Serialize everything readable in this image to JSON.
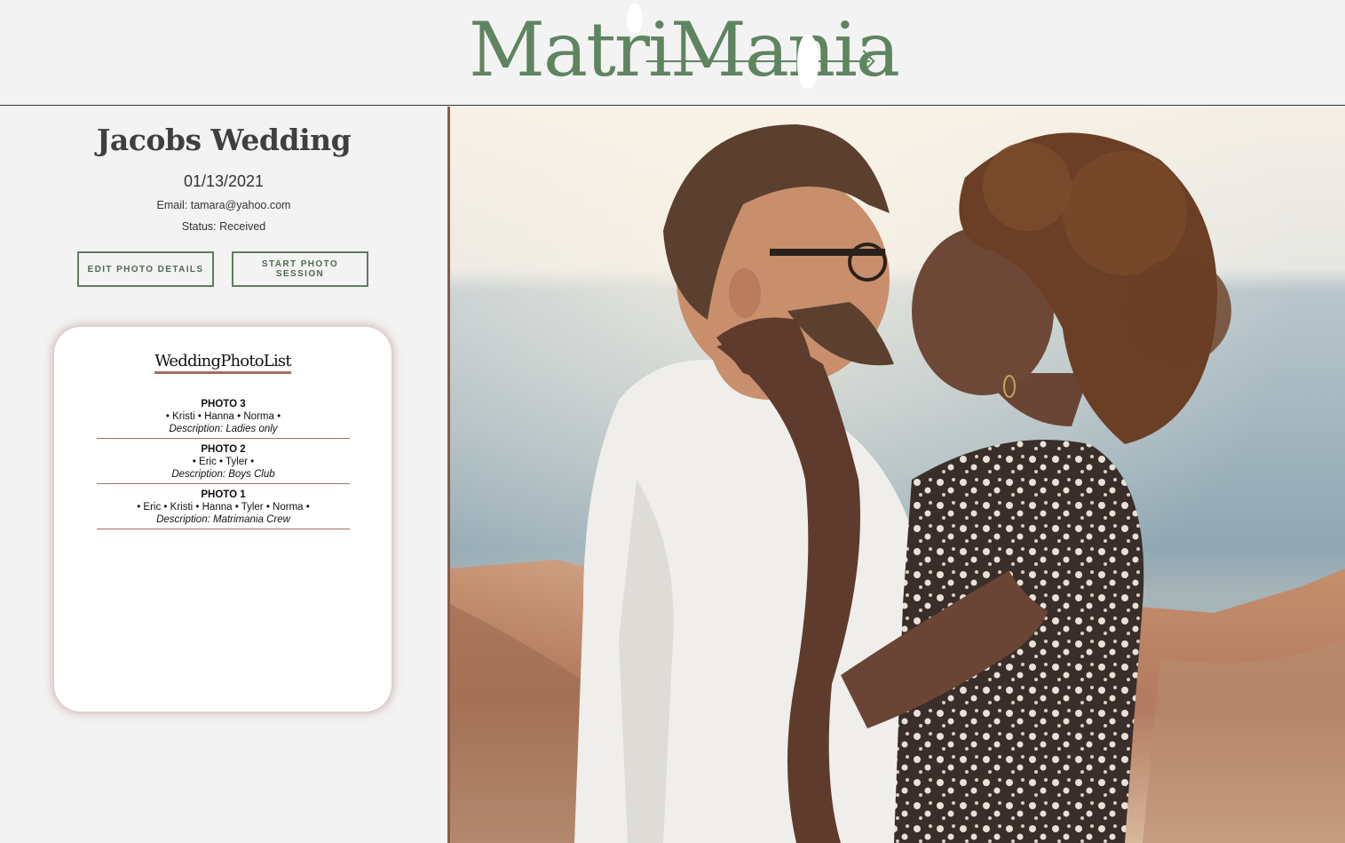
{
  "brand": {
    "name": "MatriMania",
    "color": "#5f8460"
  },
  "event": {
    "title": "Jacobs Wedding",
    "date": "01/13/2021",
    "email": "Email: tamara@yahoo.com",
    "status": "Status: Received"
  },
  "actions": {
    "edit_label": "EDIT PHOTO DETAILS",
    "start_label": "START PHOTO SESSION"
  },
  "photo_list": {
    "title": "WeddingPhotoList",
    "items": [
      {
        "name": "PHOTO 3",
        "people": "• Kristi • Hanna • Norma •",
        "description": "Description: Ladies only"
      },
      {
        "name": "PHOTO 2",
        "people": "• Eric • Tyler •",
        "description": "Description: Boys Club"
      },
      {
        "name": "PHOTO 1",
        "people": "• Eric • Kristi • Hanna • Tyler • Norma •",
        "description": "Description: Matrimania Crew"
      }
    ]
  },
  "colors": {
    "accent": "#a36e64",
    "divider": "#8a5a4c",
    "background": "#f3f3f3"
  }
}
